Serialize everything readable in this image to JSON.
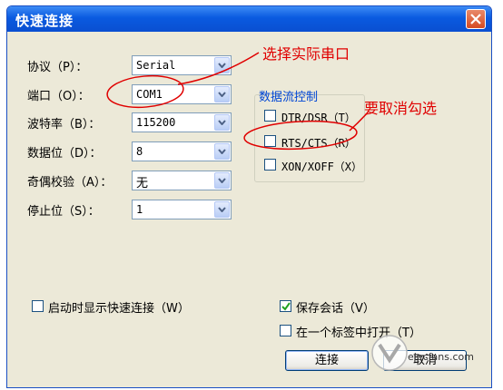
{
  "dialog": {
    "title": "快速连接"
  },
  "form": {
    "protocol": {
      "label": "协议（P）：",
      "value": "Serial"
    },
    "port": {
      "label": "端口（O）：",
      "value": "COM1"
    },
    "baud": {
      "label": "波特率（B）：",
      "value": "115200"
    },
    "databits": {
      "label": "数据位（D）：",
      "value": "8"
    },
    "parity": {
      "label": "奇偶校验（A）：",
      "value": "无"
    },
    "stopbits": {
      "label": "停止位（S）：",
      "value": "1"
    }
  },
  "flow_control": {
    "title": "数据流控制",
    "items": [
      {
        "label": "DTR/DSR（T）",
        "checked": false
      },
      {
        "label": "RTS/CTS（R）",
        "checked": false
      },
      {
        "label": "XON/XOFF（X）",
        "checked": false
      }
    ]
  },
  "options": {
    "show_on_startup": {
      "label": "启动时显示快速连接（W）",
      "checked": false
    },
    "save_session": {
      "label": "保存会话（V）",
      "checked": true
    },
    "open_in_tab": {
      "label": "在一个标签中打开（T）",
      "checked": false
    }
  },
  "buttons": {
    "connect": "连接",
    "cancel": "取消"
  },
  "annotations": {
    "select_port": "选择实际串口",
    "uncheck": "要取消勾选"
  },
  "watermark": {
    "text": "elecfans.com"
  },
  "colors": {
    "annotation": "#e00000",
    "titlebar": "#0a5ae0",
    "group_title": "#0046d5"
  }
}
